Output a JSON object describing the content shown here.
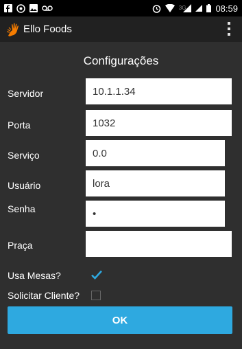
{
  "status_bar": {
    "network_label": "3G",
    "time": "08:59",
    "icons": [
      "facebook-icon",
      "whatsapp-icon",
      "gallery-icon",
      "voicemail-icon",
      "alarm-icon",
      "wifi-icon",
      "signal-icon",
      "battery-icon"
    ]
  },
  "app_bar": {
    "title": "Ello Foods",
    "logo": "hand-logo-icon",
    "menu": "overflow-menu-icon"
  },
  "form": {
    "title": "Configurações",
    "fields": [
      {
        "label": "Servidor",
        "value": "10.1.1.34",
        "type": "text"
      },
      {
        "label": "Porta",
        "value": "1032",
        "type": "text"
      },
      {
        "label": "Serviço",
        "value": "0.0",
        "type": "text"
      },
      {
        "label": "Usuário",
        "value": "lora",
        "type": "text"
      },
      {
        "label": "Senha",
        "value": "•",
        "type": "password"
      },
      {
        "label": "Praça",
        "value": "",
        "type": "text"
      }
    ],
    "usa_mesas": {
      "label": "Usa Mesas?",
      "checked": true
    },
    "solicitar_cliente": {
      "label": "Solicitar Cliente?",
      "checked": false
    },
    "ok_label": "OK"
  },
  "colors": {
    "accent": "#2ea9e0",
    "app_bar": "#212121",
    "background": "#2f2f2f",
    "logo": "#f57c00"
  }
}
